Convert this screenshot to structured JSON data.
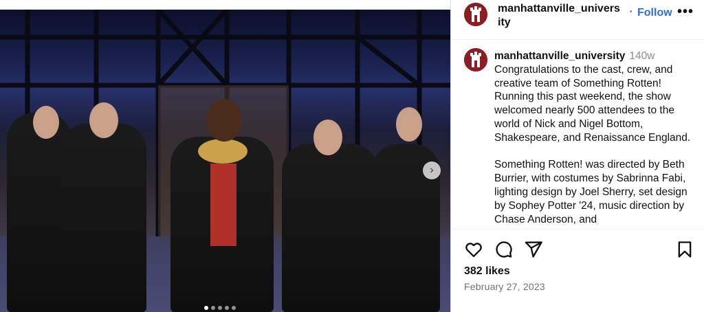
{
  "post": {
    "media": {
      "alt_description": "",
      "carousel_dots": 5,
      "active_dot": 0,
      "next_icon": "chevron-right-icon"
    },
    "author": {
      "username": "manhattanville_university",
      "separator": "•",
      "follow_label": "Follow",
      "more_icon": "more-horizontal-icon",
      "more_label": "•••",
      "avatar_color": "#8e1d23"
    },
    "caption": {
      "username": "manhattanville_university",
      "age": "140w",
      "paragraph_1": "Congratulations to the cast, crew, and creative team of Something Rotten! Running this past weekend, the show welcomed nearly 500 attendees to the world of Nick and Nigel Bottom, Shakespeare, and Renaissance England.",
      "paragraph_2": "Something Rotten! was directed by Beth Burrier, with costumes by Sabrinna Fabi, lighting design by Joel Sherry, set design by Sophey Potter '24, music direction by Chase Anderson, and"
    },
    "actions": {
      "like_icon": "heart-icon",
      "comment_icon": "comment-icon",
      "share_icon": "send-icon",
      "save_icon": "bookmark-icon"
    },
    "likes": "382 likes",
    "date": "February 27, 2023"
  },
  "colors": {
    "link_blue": "#2f6fd6",
    "muted": "#737373",
    "brand": "#8e1d23"
  }
}
